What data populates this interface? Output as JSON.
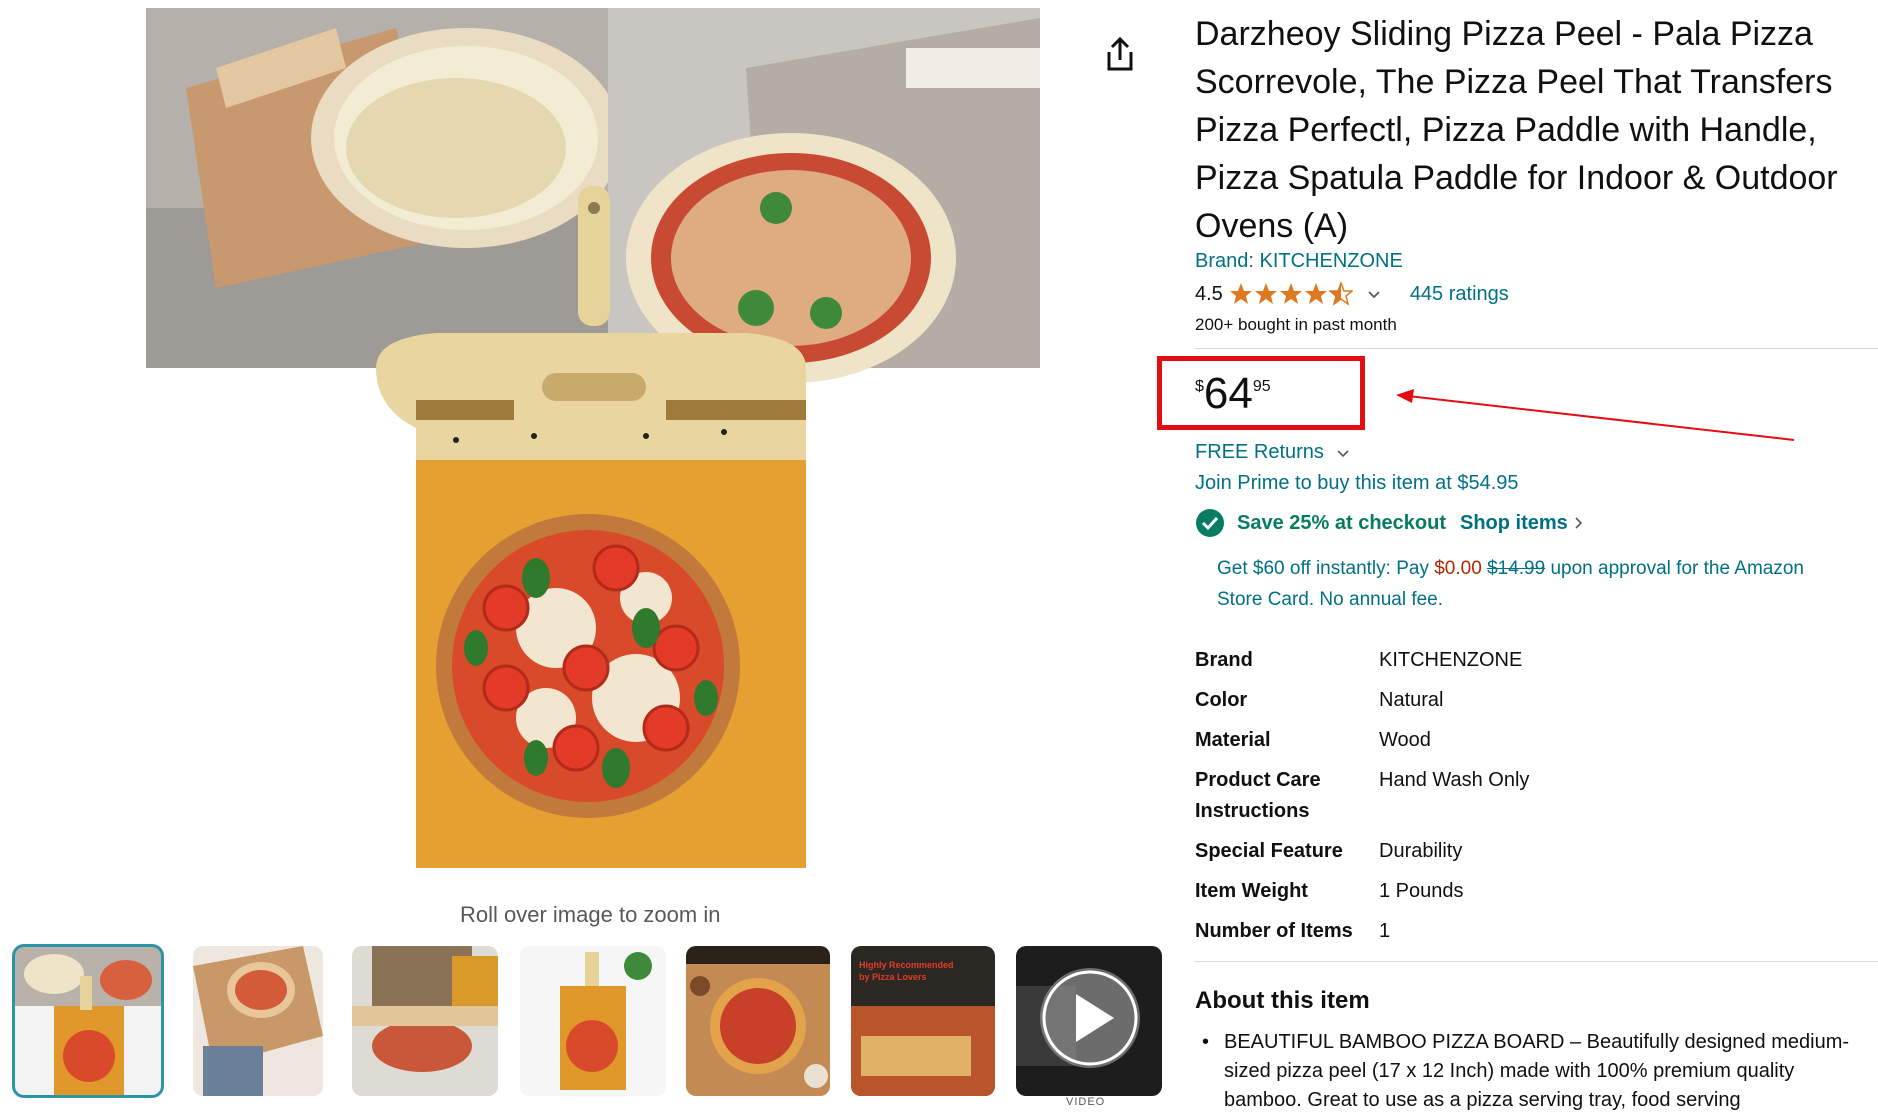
{
  "gallery": {
    "zoom_hint": "Roll over image to zoom in",
    "thumbnails": [
      {
        "name": "thumbnail-1",
        "selected": true
      },
      {
        "name": "thumbnail-2",
        "selected": false
      },
      {
        "name": "thumbnail-3",
        "selected": false
      },
      {
        "name": "thumbnail-4",
        "selected": false
      },
      {
        "name": "thumbnail-5",
        "selected": false
      },
      {
        "name": "thumbnail-6",
        "selected": false,
        "overlay_text": "Highly Recommended by Pizza Lovers"
      },
      {
        "name": "thumbnail-video",
        "selected": false
      }
    ],
    "video_label": "VIDEO"
  },
  "product": {
    "title": "Darzheoy Sliding Pizza Peel - Pala Pizza Scorrevole, The Pizza Peel That Transfers Pizza Perfectl, Pizza Paddle with Handle, Pizza Spatula Paddle for Indoor & Outdoor Ovens (A)",
    "brand_link": "Brand: KITCHENZONE",
    "rating": {
      "value": "4.5",
      "stars": 4.5,
      "ratings_link": "445 ratings"
    },
    "bought": "200+ bought in past month"
  },
  "price": {
    "symbol": "$",
    "whole": "64",
    "fraction": "95"
  },
  "offers": {
    "free_returns": "FREE Returns",
    "prime": "Join Prime to buy this item at $54.95",
    "coupon": "Save 25% at checkout",
    "shop_items": "Shop items",
    "card_prefix": "Get $60 off instantly: Pay",
    "card_new_price": "$0.00",
    "card_old_price": "$14.99",
    "card_suffix": "upon approval for the Amazon Store Card. No annual fee."
  },
  "specs": [
    {
      "label": "Brand",
      "value": "KITCHENZONE"
    },
    {
      "label": "Color",
      "value": "Natural"
    },
    {
      "label": "Material",
      "value": "Wood"
    },
    {
      "label": "Product Care Instructions",
      "value": "Hand Wash Only"
    },
    {
      "label": "Special Feature",
      "value": "Durability"
    },
    {
      "label": "Item Weight",
      "value": "1 Pounds"
    },
    {
      "label": "Number of Items",
      "value": "1"
    }
  ],
  "about": {
    "title": "About this item",
    "bullet_1": "BEAUTIFUL BAMBOO PIZZA BOARD – Beautifully designed medium-sized pizza peel (17 x 12 Inch) made with 100% premium quality bamboo. Great to use as a pizza serving tray, food serving"
  },
  "colors": {
    "link": "#007185",
    "coupon_green": "#067d62",
    "price_red": "#b12704",
    "annotation_red": "#e40d13",
    "star": "#de7921"
  }
}
